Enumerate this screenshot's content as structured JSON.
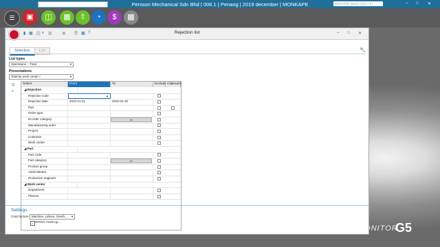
{
  "topbar": {
    "title": "Persson Mechanical Sdn Bhd | 006.1 | Penang | 2019 december | MONKAPE",
    "search_placeholder": "MONITOR search (Ctrl + F)"
  },
  "window": {
    "title": "Rejection list",
    "tabs": [
      "Selection",
      "List"
    ]
  },
  "list_types": {
    "label": "List types",
    "value": "Operations -- Total"
  },
  "presentations": {
    "label": "Presentations",
    "value": "Total by work center /"
  },
  "grid": {
    "headers": [
      "Select",
      "From",
      "To",
      "Exclude",
      "Clipboard"
    ],
    "groups": {
      "rejection": "Rejection",
      "part": "Part",
      "work_center": "Work center"
    },
    "rows": {
      "r1": "Rejection code",
      "r2": "Rejection date",
      "r2_from": "2020-01-01",
      "r2_to": "2020-04-29",
      "r3": "Part",
      "r4": "Order type",
      "r5": "M-order category",
      "r5_btn": "3>",
      "r6": "Manufacturing order",
      "r7": "Project",
      "r8": "Customer",
      "r9": "Work center",
      "p1": "Part code",
      "p2": "Part category",
      "p2_btn": "3>",
      "p3": "Product group",
      "p4": "Administrator",
      "p5": "Production engineer",
      "w1": "Department",
      "w2": "Planner"
    }
  },
  "settings": {
    "label": "Settings",
    "cost_factors_label": "Cost factors",
    "cost_factors_value": "Machine, Labour, Overh...",
    "markup_label": "SO/SC mark-up",
    "markup_checked": true
  },
  "branding": {
    "g5": "G5",
    "brand": "MONITOR"
  },
  "colors": {
    "topbar": "#1f6f9a",
    "accent": "#1d6fa5",
    "app_red": "#d2232a",
    "app_green": "#6cbf2b",
    "app_blue": "#1e73be",
    "app_purple": "#a03ab8",
    "app_gray": "#8a8a8a"
  }
}
